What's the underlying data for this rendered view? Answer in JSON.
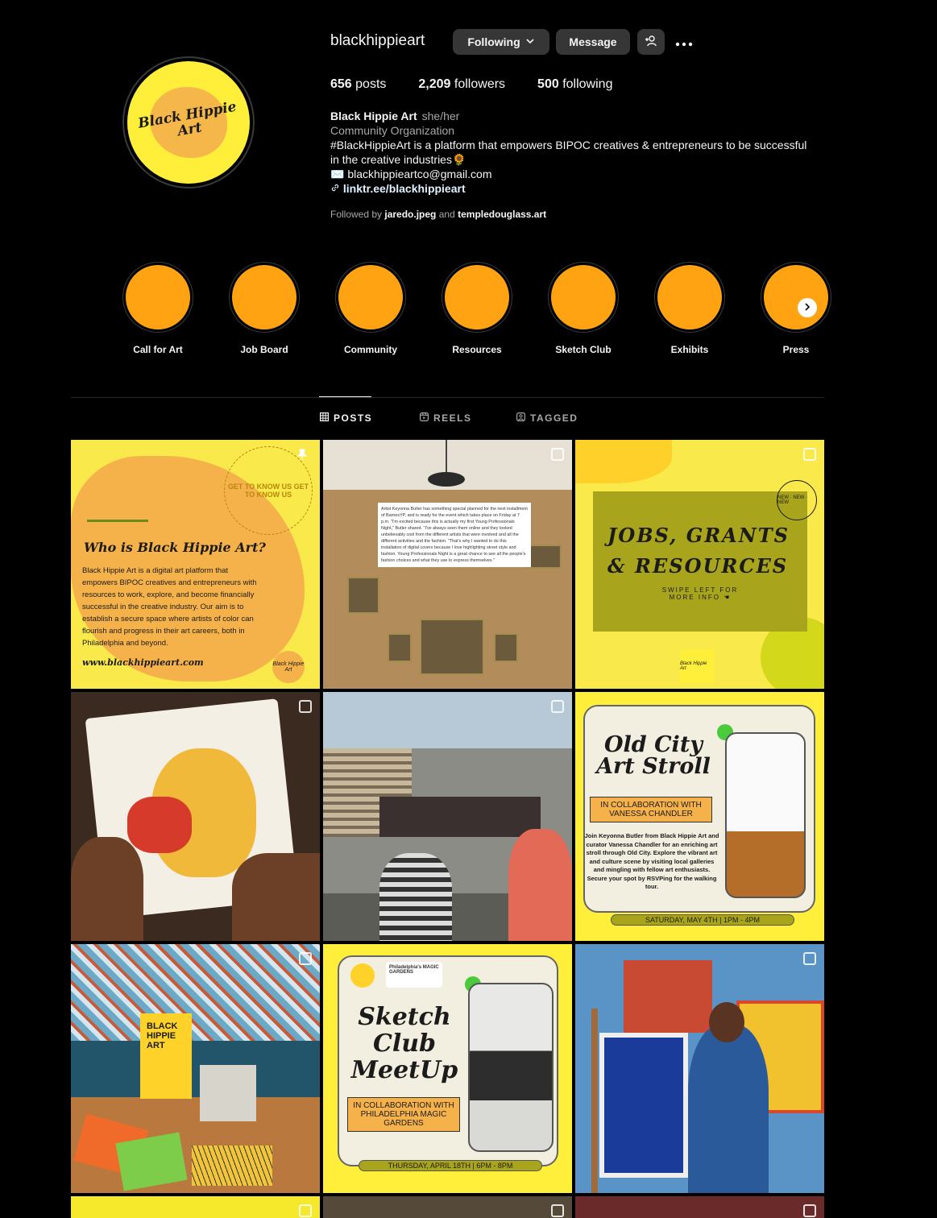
{
  "profile": {
    "username": "blackhippieart",
    "avatar_text": "Black Hippie Art",
    "buttons": {
      "following": "Following",
      "message": "Message"
    },
    "stats": {
      "posts_count": "656",
      "posts_label": "posts",
      "followers_count": "2,209",
      "followers_label": "followers",
      "following_count": "500",
      "following_label": "following"
    },
    "bio": {
      "display_name": "Black Hippie Art",
      "pronouns": "she/her",
      "category": "Community Organization",
      "description": "#BlackHippieArt is a platform that empowers BIPOC creatives & entrepreneurs to be successful in the creative industries🌻",
      "email": "✉️ blackhippieartco@gmail.com",
      "link": "linktr.ee/blackhippieart"
    },
    "followed_by": {
      "prefix": "Followed by",
      "user1": "jaredo.jpeg",
      "conj": "and",
      "user2": "templedouglass.art"
    }
  },
  "highlights": [
    {
      "label": "Call for Art"
    },
    {
      "label": "Job Board"
    },
    {
      "label": "Community"
    },
    {
      "label": "Resources"
    },
    {
      "label": "Sketch Club"
    },
    {
      "label": "Exhibits"
    },
    {
      "label": "Press"
    }
  ],
  "highlight_color": "#ffa313",
  "tabs": {
    "posts": "POSTS",
    "reels": "REELS",
    "tagged": "TAGGED"
  },
  "posts": {
    "p1": {
      "circle_text": "GET TO KNOW US GET TO KNOW US",
      "title": "Who is Black Hippie Art?",
      "body": "Black Hippie Art is a digital art platform that empowers BIPOC creatives and entrepreneurs with resources to work, explore, and become financially successful in the creative industry. Our aim is to establish a secure space where artists of color can flourish and progress in their art careers, both in Philadelphia and beyond.",
      "url": "www.blackhippieart.com",
      "logo": "Black Hippie Art"
    },
    "p2": {
      "quote": "Artist Keyonna Butler has something special planned for the next installment of BarnesYP, and is ready for the event which takes place on Friday at 7 p.m. \"I'm excited because this is actually my first Young Professionals Night,\" Butler shared. \"I've always seen them online and they looked unbelievably cool from the different artists that were involved and all the different activities and the fashion. \"That's why I wanted to do this installation of digital covers because I love highlighting street style and fashion. Young Professionals Night is a great chance to see all the people's fashion choices and what they use to express themselves.\""
    },
    "p3": {
      "line1": "JOBS, GRANTS",
      "line2": "& RESOURCES",
      "sub": "SWIPE LEFT FOR MORE INFO ☚",
      "badge": "NEW · NEW · NEW",
      "logo": "Black Hippie Art"
    },
    "p6": {
      "title": "Old City Art Stroll",
      "collab": "IN COLLABORATION WITH VANESSA CHANDLER",
      "desc": "Join Keyonna Butler from Black Hippie Art and curator Vanessa Chandler for an enriching art stroll through Old City. Explore the vibrant art and culture scene by visiting local galleries and mingling with fellow art enthusiasts. Secure your spot by RSVPing for the walking tour.",
      "date": "SATURDAY, MAY 4TH | 1PM - 4PM"
    },
    "p7": {
      "poster": "BLACK HIPPIE ART"
    },
    "p8": {
      "title": "Sketch Club MeetUp",
      "collab": "IN COLLABORATION WITH PHILADELPHIA MAGIC GARDENS",
      "partner": "Philadelphia's MAGIC GARDENS",
      "date": "THURSDAY, APRIL 18TH | 6PM - 8PM"
    }
  },
  "colors": {
    "background": "#000000",
    "button_bg": "#363636",
    "muted_text": "#a8a8a8",
    "brand_yellow": "#ffee3a"
  }
}
